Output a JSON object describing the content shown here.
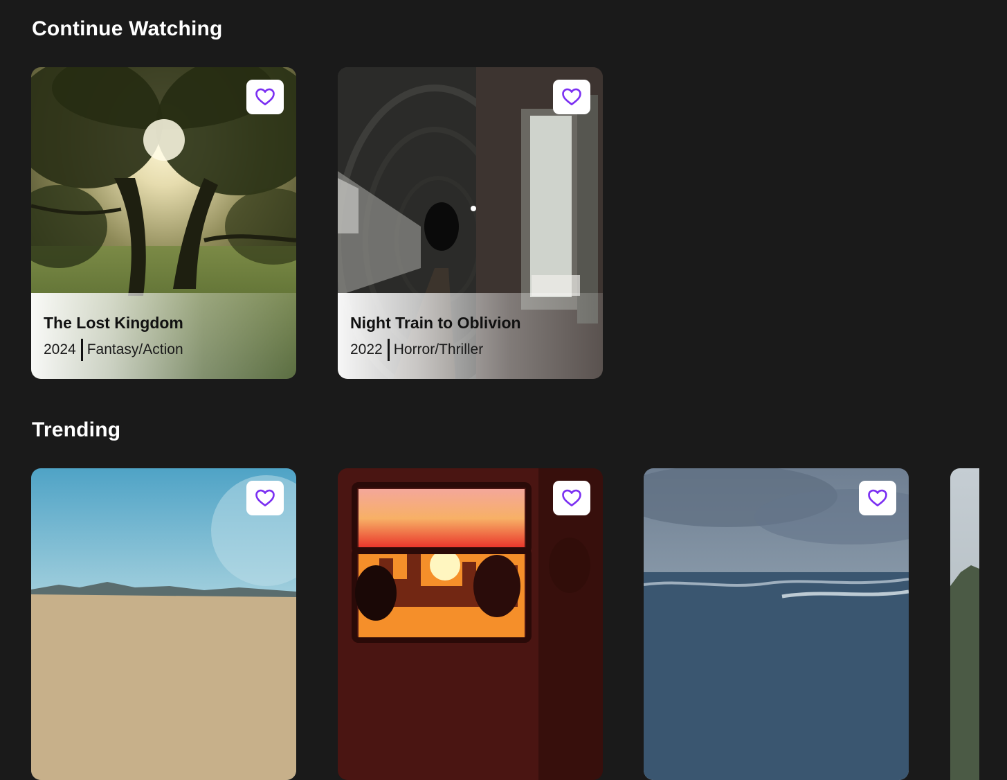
{
  "continue_watching": {
    "heading": "Continue Watching",
    "items": [
      {
        "title": "The Lost Kingdom",
        "year": "2024",
        "genre": "Fantasy/Action",
        "favorite_icon": "heart-icon"
      },
      {
        "title": "Night Train to Oblivion",
        "year": "2022",
        "genre": "Horror/Thriller",
        "favorite_icon": "heart-icon"
      }
    ]
  },
  "trending": {
    "heading": "Trending",
    "items": [
      {
        "favorite_icon": "heart-icon"
      },
      {
        "favorite_icon": "heart-icon"
      },
      {
        "favorite_icon": "heart-icon"
      },
      {}
    ]
  },
  "colors": {
    "background": "#1a1a1a",
    "accent": "#7b2ff2",
    "favorite_button_bg": "#ffffff"
  }
}
